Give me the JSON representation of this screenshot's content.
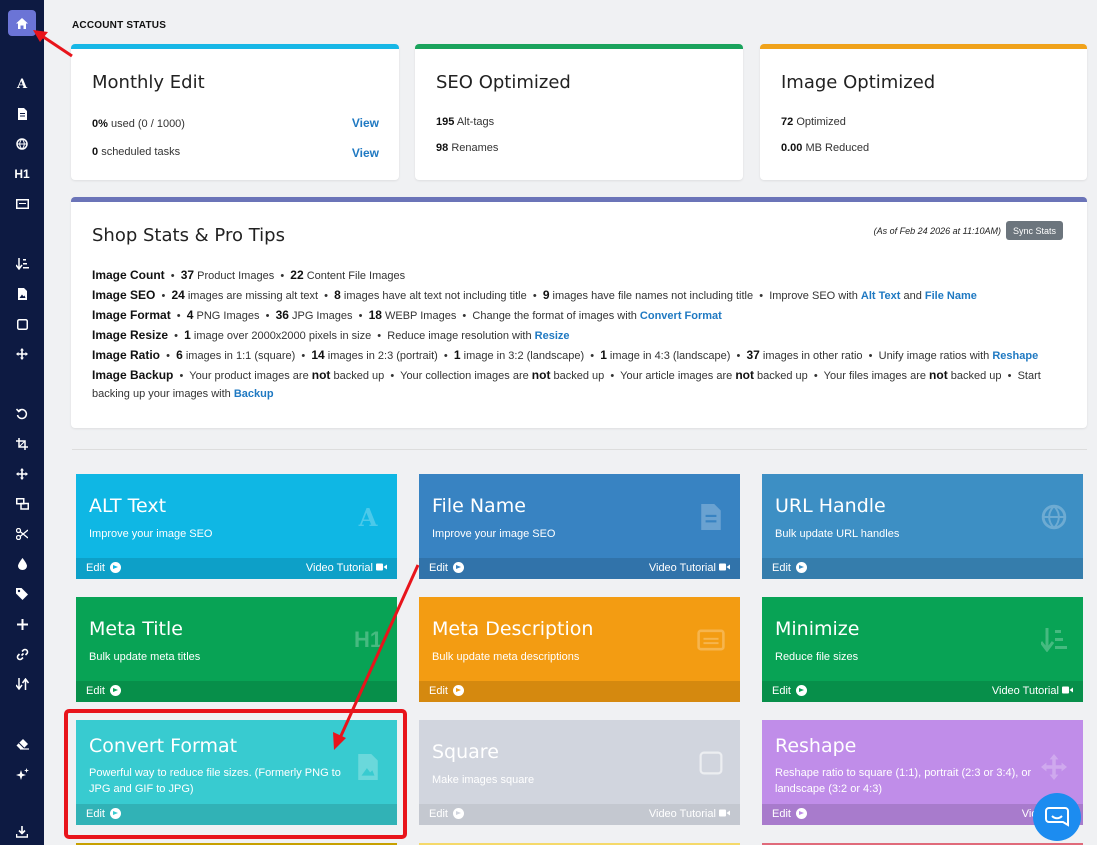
{
  "account_status": {
    "title": "ACCOUNT STATUS",
    "monthly_edit": {
      "title": "Monthly Edit",
      "used_value": "0%",
      "used_label": "used (0 / 1000)",
      "scheduled_value": "0",
      "scheduled_label": "scheduled tasks",
      "view1": "View",
      "view2": "View",
      "color": "#17b7e6"
    },
    "seo": {
      "title": "SEO Optimized",
      "alt_value": "195",
      "alt_label": "Alt-tags",
      "rename_value": "98",
      "rename_label": "Renames",
      "color": "#1aa35c"
    },
    "image": {
      "title": "Image Optimized",
      "opt_value": "72",
      "opt_label": "Optimized",
      "mb_value": "0.00",
      "mb_label": "MB Reduced",
      "color": "#f0a21a"
    }
  },
  "shop_stats": {
    "title": "Shop Stats & Pro Tips",
    "as_of": "(As of Feb 24 2026 at 11:10AM)",
    "sync_button": "Sync Stats",
    "color": "#6b74b8"
  },
  "tiles": {
    "alt_text": {
      "title": "ALT Text",
      "desc": "Improve your image SEO",
      "edit": "Edit",
      "video": "Video Tutorial",
      "color": "#0fb7e4"
    },
    "file_name": {
      "title": "File Name",
      "desc": "Improve your image SEO",
      "edit": "Edit",
      "video": "Video Tutorial",
      "color": "#3883c2"
    },
    "url_handle": {
      "title": "URL Handle",
      "desc": "Bulk update URL handles",
      "edit": "Edit",
      "color": "#3d8fc4"
    },
    "meta_title": {
      "title": "Meta Title",
      "desc": "Bulk update meta titles",
      "edit": "Edit",
      "icon": "H1",
      "color": "#08a355"
    },
    "meta_description": {
      "title": "Meta Description",
      "desc": "Bulk update meta descriptions",
      "edit": "Edit",
      "color": "#f39c12"
    },
    "minimize": {
      "title": "Minimize",
      "desc": "Reduce file sizes",
      "edit": "Edit",
      "video": "Video Tutorial",
      "color": "#08a355"
    },
    "convert_format": {
      "title": "Convert Format",
      "desc": "Powerful way to reduce file sizes. (Formerly PNG to JPG and GIF to JPG)",
      "edit": "Edit",
      "color": "#38cbd0"
    },
    "square": {
      "title": "Square",
      "desc": "Make images square",
      "edit": "Edit",
      "video": "Video Tutorial",
      "color": "#d1d5de"
    },
    "reshape": {
      "title": "Reshape",
      "desc": "Reshape ratio to square (1:1), portrait (2:3 or 3:4), or landscape (3:2 or 4:3)",
      "edit": "Edit",
      "video": "Video Tu",
      "color": "#c08de9"
    }
  },
  "sidebar": {
    "h1_label": "H1",
    "active_color": "#6b74d6",
    "bg_color": "#0d1a42"
  },
  "annotation_color": "#e8141b"
}
